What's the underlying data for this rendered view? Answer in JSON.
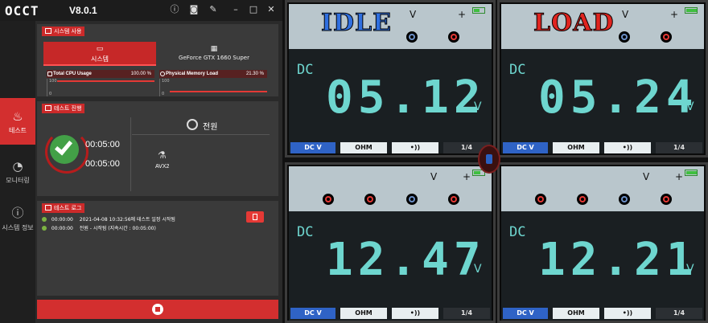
{
  "app": {
    "logo": "OCCT",
    "version": "V8.0.1",
    "title_icons": [
      "info-icon",
      "camera-icon",
      "wrench-icon",
      "minimize-icon",
      "maximize-icon",
      "close-icon"
    ]
  },
  "sidebar": {
    "items": [
      {
        "label": "테스트",
        "icon": "flame-icon",
        "active": true
      },
      {
        "label": "모니터링",
        "icon": "gauge-icon",
        "active": false
      },
      {
        "label": "시스템 정보",
        "icon": "info-icon",
        "active": false
      }
    ]
  },
  "system_usage": {
    "header": "시스템 사용",
    "tabs": [
      {
        "label": "시스템",
        "icon": "laptop-icon"
      },
      {
        "label": "GeForce GTX 1660 Super",
        "icon": "gpu-icon"
      }
    ],
    "stats": [
      {
        "label": "Total CPU Usage",
        "value": "100.00 %",
        "max": "100",
        "min": "0"
      },
      {
        "label": "Physical Memory Load",
        "value": "21.30 %",
        "max": "100",
        "min": "0"
      }
    ]
  },
  "test_progress": {
    "header": "테스트 진행",
    "elapsed": "00:05:00",
    "total": "00:05:00",
    "mode": "전원",
    "instruction_set": "AVX2"
  },
  "test_log": {
    "header": "테스트 로그",
    "lines": [
      {
        "time": "00:00:00",
        "text": "2021-04-08 10:32:56에 테스트 일정 시작됨"
      },
      {
        "time": "00:00:00",
        "text": "전원 - 시작됨 (지속시간 : 00:05:00)"
      }
    ]
  },
  "multimeters": [
    {
      "tag": "IDLE",
      "mode": "DC",
      "value": "05.12",
      "unit": "V"
    },
    {
      "tag": "LOAD",
      "mode": "DC",
      "value": "05.24",
      "unit": "V"
    },
    {
      "tag": "",
      "mode": "DC",
      "value": "12.47",
      "unit": "V"
    },
    {
      "tag": "",
      "mode": "DC",
      "value": "12.21",
      "unit": "V"
    }
  ],
  "softkeys": [
    "DC V",
    "OHM",
    "•))",
    "1/4"
  ],
  "multimeter_symbols": {
    "v": "V",
    "plus": "+"
  },
  "colors": {
    "accent": "#d32f2f",
    "idle_tag": "#2f6fe0",
    "load_tag": "#e0241f",
    "lcd_digits": "#6ed6cf"
  }
}
